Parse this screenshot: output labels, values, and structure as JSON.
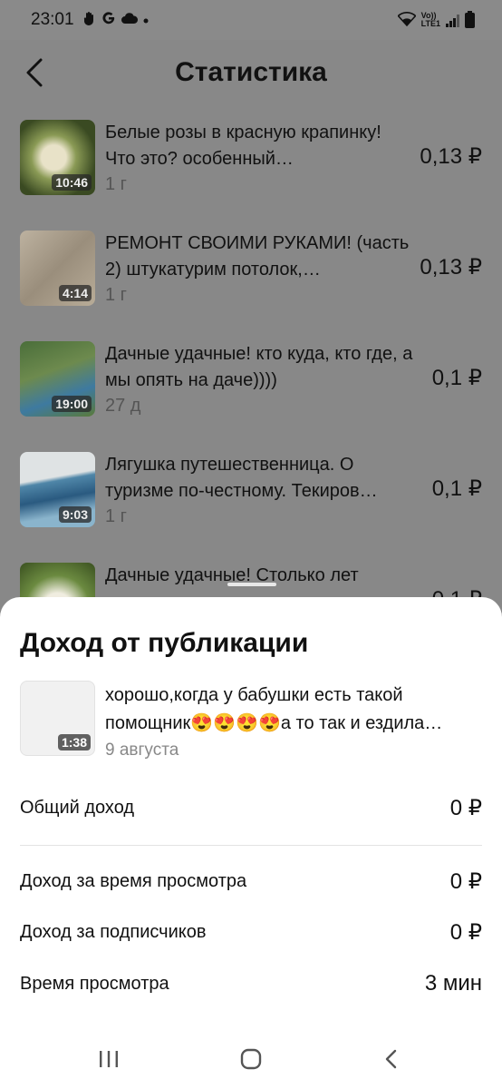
{
  "status_bar": {
    "time": "23:01",
    "left_icons": [
      "hand-icon",
      "google-icon",
      "cloud-icon",
      "dot-icon"
    ],
    "network_label_top": "Vo))",
    "network_label_bottom": "LTE1"
  },
  "header": {
    "title": "Статистика",
    "back_icon": "chevron-left-icon"
  },
  "videos": [
    {
      "title": "Белые розы в красную крапинку! Что это? особенный…",
      "duration": "10:46",
      "age": "1 г",
      "earnings": "0,13 ₽"
    },
    {
      "title": "РЕМОНТ СВОИМИ РУКАМИ! (часть 2) штукатурим потолок,…",
      "duration": "4:14",
      "age": "1 г",
      "earnings": "0,13 ₽"
    },
    {
      "title": "Дачные удачные! кто куда, кто где, а мы опять на даче))))",
      "duration": "19:00",
      "age": "27 д",
      "earnings": "0,1 ₽"
    },
    {
      "title": "Лягушка путешественница. О туризме по-честному. Текиров…",
      "duration": "9:03",
      "age": "1 г",
      "earnings": "0,1 ₽"
    },
    {
      "title": "Дачные удачные! Столько лет",
      "duration": "",
      "age": "",
      "earnings": "0,1 ₽"
    }
  ],
  "sheet": {
    "title": "Доход от публикации",
    "video": {
      "title": "хорошо,когда у бабушки есть такой помощник😍😍😍😍а то так и ездила…",
      "duration": "1:38",
      "date": "9 августа"
    },
    "stats": [
      {
        "label": "Общий доход",
        "value": "0 ₽"
      },
      {
        "label": "Доход за время просмотра",
        "value": "0 ₽"
      },
      {
        "label": "Доход за подписчиков",
        "value": "0 ₽"
      },
      {
        "label": "Время просмотра",
        "value": "3 мин"
      }
    ]
  },
  "navbar": {
    "buttons": [
      "recent-apps-icon",
      "home-icon",
      "back-icon"
    ]
  }
}
